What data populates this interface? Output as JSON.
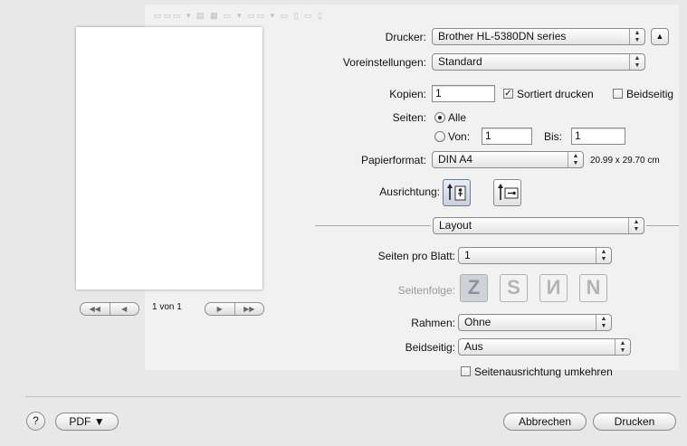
{
  "printer": {
    "label": "Drucker:",
    "value": "Brother HL-5380DN series"
  },
  "presets": {
    "label": "Voreinstellungen:",
    "value": "Standard"
  },
  "copies": {
    "label": "Kopien:",
    "value": "1",
    "collate_label": "Sortiert drucken",
    "collate_checked": true,
    "duplex_label": "Beidseitig",
    "duplex_checked": false
  },
  "pages": {
    "label": "Seiten:",
    "all_label": "Alle",
    "from_label": "Von:",
    "from_value": "1",
    "to_label": "Bis:",
    "to_value": "1"
  },
  "paper": {
    "label": "Papierformat:",
    "value": "DIN A4",
    "size_text": "20.99 x 29.70 cm"
  },
  "orientation": {
    "label": "Ausrichtung:"
  },
  "panel": {
    "value": "Layout"
  },
  "layout": {
    "pages_per_sheet_label": "Seiten pro Blatt:",
    "pages_per_sheet_value": "1",
    "order_label": "Seitenfolge:",
    "border_label": "Rahmen:",
    "border_value": "Ohne",
    "two_sided_label": "Beidseitig:",
    "two_sided_value": "Aus",
    "reverse_label": "Seitenausrichtung umkehren",
    "reverse_checked": false
  },
  "preview": {
    "page_text": "1 von 1"
  },
  "bottom": {
    "help": "?",
    "pdf": "PDF ▼",
    "cancel": "Abbrechen",
    "print": "Drucken"
  },
  "icons": {
    "updown": "updown-arrows-icon",
    "disclosure": "disclosure-triangle-icon"
  },
  "colors": {
    "background": "#e8e8e8",
    "button_border": "#8a8a8a"
  }
}
